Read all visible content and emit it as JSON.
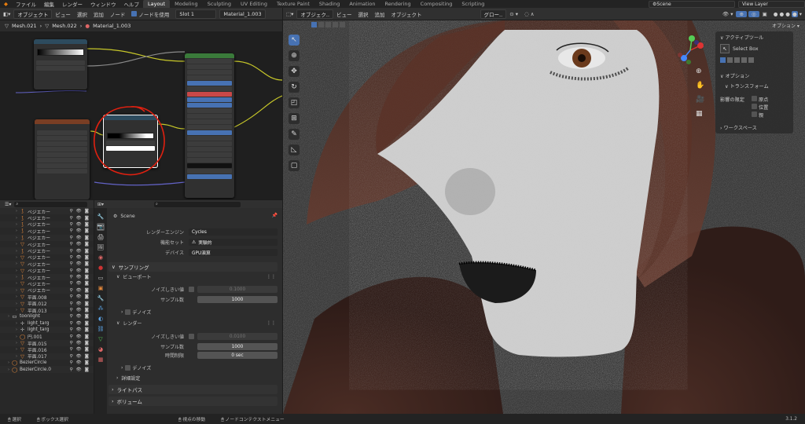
{
  "menu": [
    "ファイル",
    "編集",
    "レンダー",
    "ウィンドウ",
    "ヘルプ"
  ],
  "workspaces": [
    "Layout",
    "Modeling",
    "Sculpting",
    "UV Editing",
    "Texture Paint",
    "Shading",
    "Animation",
    "Rendering",
    "Compositing",
    "Scripting"
  ],
  "scene": "Scene",
  "view_layer": "View Layer",
  "node_header": {
    "type": "オブジェクト",
    "menus": [
      "ビュー",
      "選択",
      "追加",
      "ノード"
    ],
    "use_nodes": "ノードを使用",
    "slot": "Slot 1",
    "material": "Material_1.003"
  },
  "breadcrumb": [
    "Mesh.021",
    "Mesh.022",
    "Material_1.003"
  ],
  "vp_header": {
    "mode": "オブジェク..",
    "menus": [
      "ビュー",
      "選択",
      "追加",
      "オブジェクト"
    ],
    "transform": "グロー..",
    "options": "オプション"
  },
  "outliner": [
    {
      "name": "ベジエカー",
      "indent": 2,
      "icon": "curve-icon"
    },
    {
      "name": "ベジエカー",
      "indent": 2,
      "icon": "curve-icon"
    },
    {
      "name": "ベジエカー",
      "indent": 2,
      "icon": "curve-icon"
    },
    {
      "name": "ベジエカー",
      "indent": 2,
      "icon": "curve-icon"
    },
    {
      "name": "ベジエカー",
      "indent": 2,
      "icon": "curve-icon"
    },
    {
      "name": "ベジエカー",
      "indent": 2,
      "icon": "mesh-icon"
    },
    {
      "name": "ベジエカー",
      "indent": 2,
      "icon": "curve-icon"
    },
    {
      "name": "ベジエカー",
      "indent": 2,
      "icon": "mesh-icon"
    },
    {
      "name": "ベジエカー",
      "indent": 2,
      "icon": "mesh-icon"
    },
    {
      "name": "ベジエカー",
      "indent": 2,
      "icon": "mesh-icon"
    },
    {
      "name": "ベジエカー",
      "indent": 2,
      "icon": "curve-icon"
    },
    {
      "name": "ベジエカー",
      "indent": 2,
      "icon": "mesh-icon"
    },
    {
      "name": "ベジエカー",
      "indent": 2,
      "icon": "mesh-icon"
    },
    {
      "name": "平面.008",
      "indent": 2,
      "icon": "mesh-icon"
    },
    {
      "name": "平面.012",
      "indent": 2,
      "icon": "mesh-icon"
    },
    {
      "name": "平面.013",
      "indent": 2,
      "icon": "mesh-icon"
    },
    {
      "name": "toonlight",
      "indent": 1,
      "icon": "collection-icon"
    },
    {
      "name": "light_targ",
      "indent": 2,
      "icon": "empty-icon"
    },
    {
      "name": "light_targ",
      "indent": 2,
      "icon": "empty-icon"
    },
    {
      "name": "円.001",
      "indent": 2,
      "icon": "circle-icon"
    },
    {
      "name": "平面.015",
      "indent": 2,
      "icon": "mesh-icon"
    },
    {
      "name": "平面.016",
      "indent": 2,
      "icon": "mesh-icon"
    },
    {
      "name": "平面.017",
      "indent": 2,
      "icon": "mesh-icon"
    },
    {
      "name": "BezierCircle",
      "indent": 1,
      "icon": "circle-icon"
    },
    {
      "name": "BezierCircle.0",
      "indent": 1,
      "icon": "circle-icon"
    }
  ],
  "props": {
    "scene_name": "Scene",
    "render_engine_label": "レンダーエンジン",
    "render_engine": "Cycles",
    "feature_set_label": "機能セット",
    "feature_set": "実験的",
    "device_label": "デバイス",
    "device": "GPU演算",
    "sampling": "サンプリング",
    "viewport": "ビューポート",
    "noise_threshold_label": "ノイズしきい値",
    "noise_threshold_vp": "0.1000",
    "samples_label": "サンプル数",
    "samples_vp": "1000",
    "denoise": "デノイズ",
    "render": "レンダー",
    "noise_threshold_r": "0.0100",
    "samples_r": "1000",
    "time_limit_label": "時間制限",
    "time_limit": "0 sec",
    "advanced": "詳細設定",
    "light_paths": "ライトパス",
    "volumes": "ボリューム"
  },
  "npanel": {
    "active_tool": "アクティブツール",
    "select_box": "Select Box",
    "options": "オプション",
    "transform": "トランスフォーム",
    "affect_only": "影響の限定",
    "origin": "原点",
    "position": "位置",
    "parent": "親",
    "workspace": "ワークスペース"
  },
  "status": {
    "select": "選択",
    "box_select": "ボックス選択",
    "pan": "視点の移動",
    "context_menu": "ノードコンテクストメニュー",
    "version": "3.1.2"
  }
}
